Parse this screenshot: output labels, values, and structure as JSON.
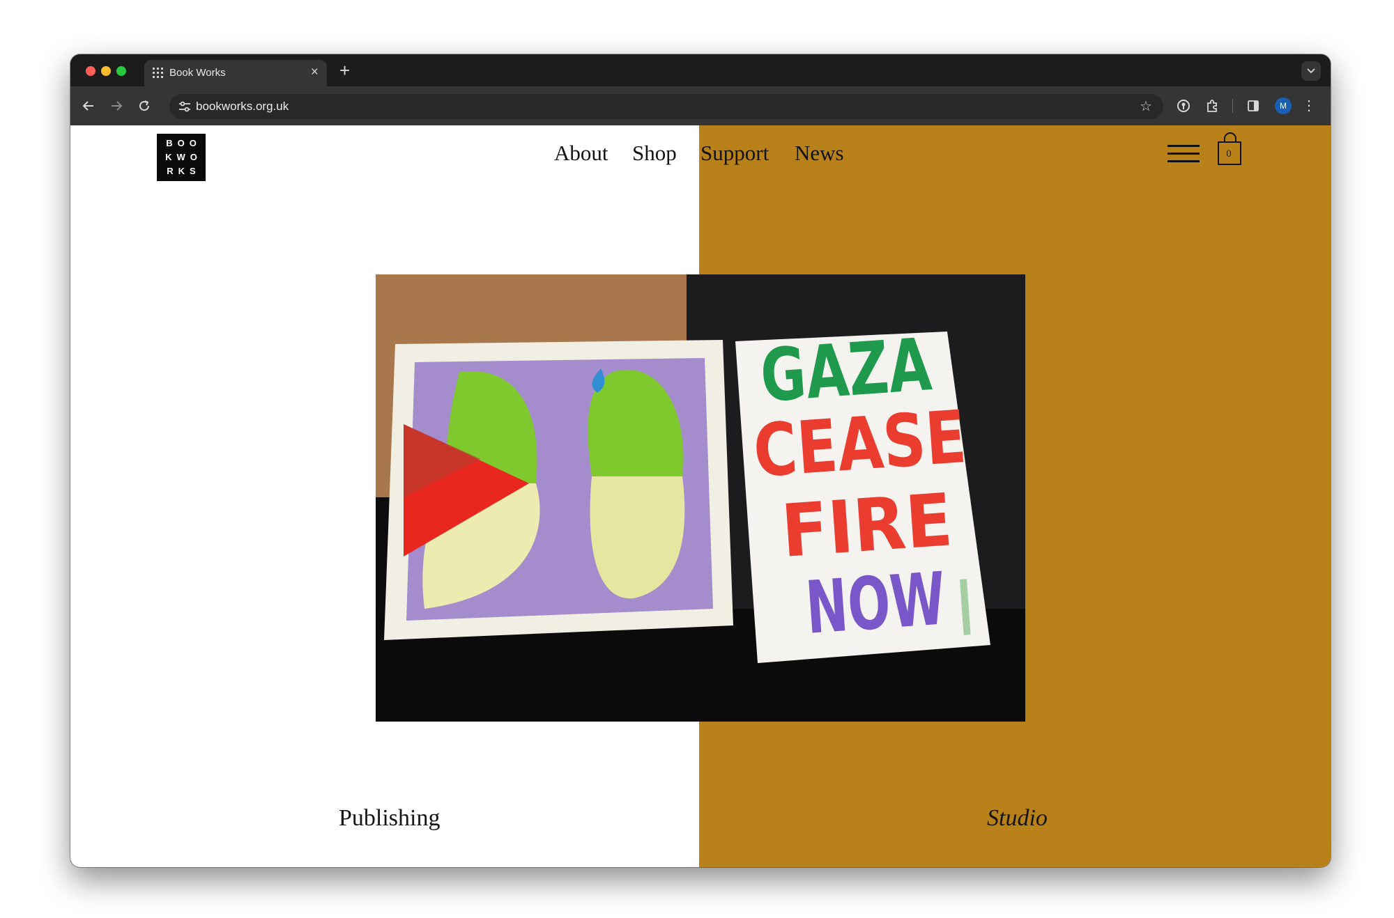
{
  "browser": {
    "tab_title": "Book Works",
    "tab_close": "×",
    "new_tab": "+",
    "tab_menu": "⌄",
    "url": "bookworks.org.uk",
    "profile_initial": "M",
    "icons": [
      "back-icon",
      "forward-icon",
      "reload-icon",
      "site-settings-icon",
      "bookmark-star-icon",
      "password-key-icon",
      "extensions-icon",
      "side-panel-icon",
      "menu-kebab-icon"
    ]
  },
  "site": {
    "logo_rows": [
      "BOO",
      "KWO",
      "RKS"
    ],
    "nav": [
      {
        "label": "About"
      },
      {
        "label": "Shop"
      },
      {
        "label": "Support"
      },
      {
        "label": "News"
      }
    ],
    "cart_count": "0",
    "hero_image": {
      "poster_lines": [
        "GAZA",
        "CEASE",
        "FIRE",
        "NOW"
      ],
      "poster_colors": [
        "#1f9a4c",
        "#ea3c2f",
        "#ea3c2f",
        "#7a57c8"
      ]
    },
    "sections": {
      "left": "Publishing",
      "right": "Studio"
    }
  },
  "colors": {
    "studio_panel": "#b8811a",
    "chrome_dark": "#1f1f1f",
    "toolbar": "#353535"
  }
}
